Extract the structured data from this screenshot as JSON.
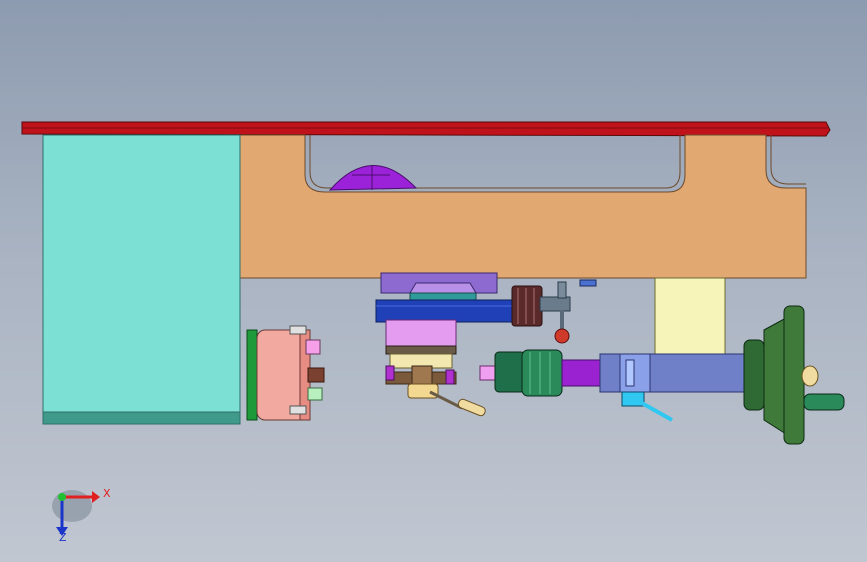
{
  "triad": {
    "x_label": "X",
    "z_label": "Z",
    "x_color": "#e02020",
    "z_color": "#1a35c8",
    "origin_color": "#20c030"
  },
  "colors": {
    "background_top": "#8d9bb0",
    "background_bottom": "#c1c7d1",
    "bed_top": "#c0121a",
    "headstock": "#7de0d4",
    "bed_body": "#e2a872",
    "chuck": "#f2a9a0",
    "carriage_saddle": "#2040b8",
    "cross_slide": "#e39cf0",
    "tailstock_body": "#7080c8",
    "tailstock_support": "#f6f4b8",
    "handwheel": "#3f7a3a",
    "purple_wheel": "#9b22d8"
  }
}
